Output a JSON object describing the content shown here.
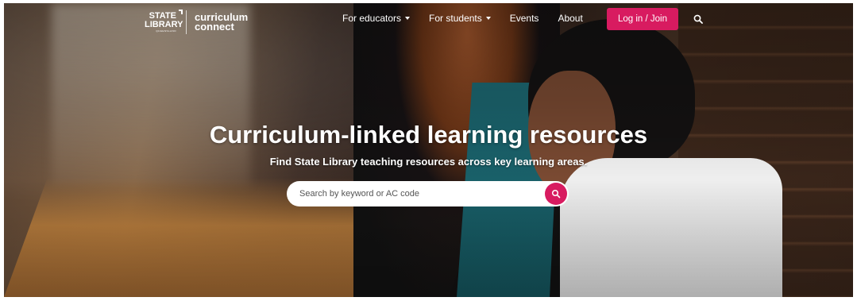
{
  "brand": {
    "library_name": "STATE LIBRARY",
    "library_subtitle": "QUEENSLAND",
    "site_name": "curriculum connect"
  },
  "nav": {
    "items": [
      {
        "label": "For educators",
        "has_dropdown": true
      },
      {
        "label": "For students",
        "has_dropdown": true
      },
      {
        "label": "Events",
        "has_dropdown": false
      },
      {
        "label": "About",
        "has_dropdown": false
      }
    ],
    "login_label": "Log in / Join",
    "search_icon": "search-icon"
  },
  "hero": {
    "title": "Curriculum-linked learning resources",
    "subtitle": "Find State Library teaching resources across key learning areas.",
    "search_placeholder": "Search by keyword or AC code",
    "search_icon": "search-icon"
  },
  "colors": {
    "accent": "#d81b60",
    "text_on_image": "#ffffff"
  }
}
